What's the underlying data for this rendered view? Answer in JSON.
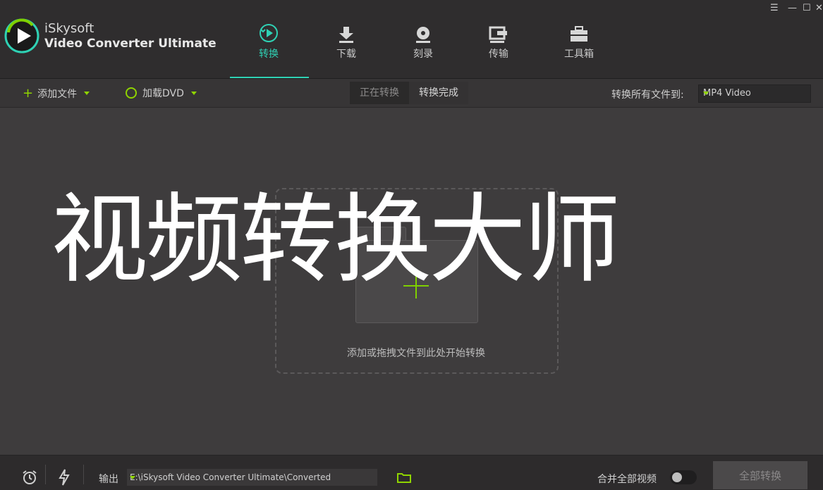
{
  "app": {
    "brand_line1": "iSkysoft",
    "brand_line2": "Video Converter Ultimate"
  },
  "nav": {
    "tabs": [
      {
        "label": "转换",
        "icon": "convert-play-icon",
        "active": true
      },
      {
        "label": "下载",
        "icon": "download-icon",
        "active": false
      },
      {
        "label": "刻录",
        "icon": "burn-disc-icon",
        "active": false
      },
      {
        "label": "传输",
        "icon": "transfer-icon",
        "active": false
      },
      {
        "label": "工具箱",
        "icon": "toolbox-icon",
        "active": false
      }
    ],
    "accent_color": "#2fd1b4"
  },
  "toolbar": {
    "add_files": "添加文件",
    "load_dvd": "加载DVD",
    "segment_converting": "正在转换",
    "segment_converted": "转换完成",
    "convert_all_to_label": "转换所有文件到:",
    "format_selected": "MP4 Video"
  },
  "main": {
    "drop_hint": "添加或拖拽文件到此处开始转换",
    "watermark_text": "视频转换大师"
  },
  "bottom": {
    "output_label": "输出",
    "output_path": "E:\\iSkysoft Video Converter Ultimate\\Converted",
    "merge_label": "合并全部视频",
    "convert_all_button": "全部转换"
  },
  "colors": {
    "green_accent": "#7fd000"
  }
}
